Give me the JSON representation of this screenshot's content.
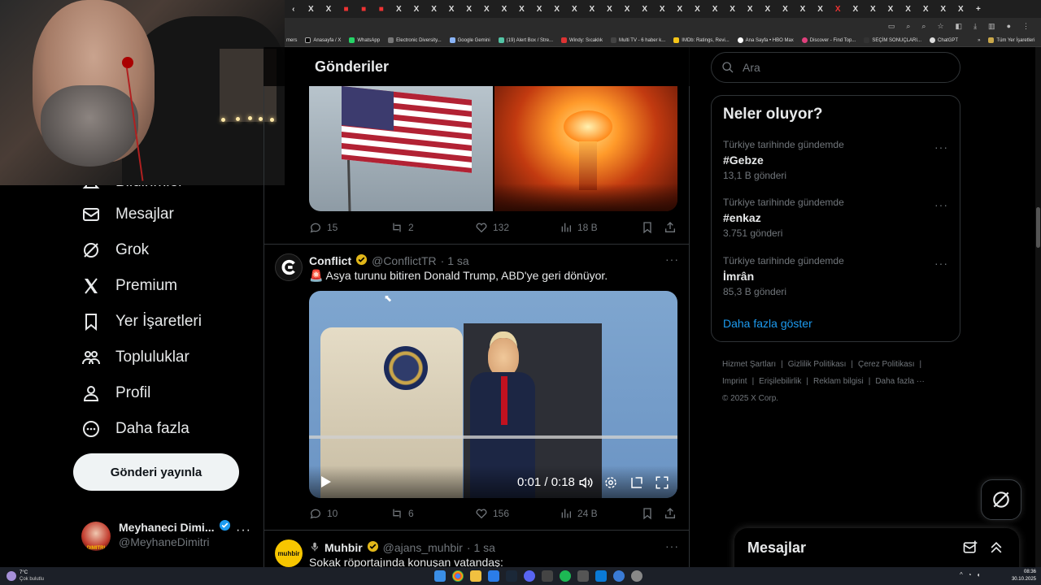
{
  "browser": {
    "bookmarks": [
      "mers",
      "Anasayfa / X",
      "WhatsApp",
      "Electronic Diversity...",
      "Google Gemini",
      "(19) Alert Box / Stre...",
      "Windy: Sıcaklık",
      "Multi TV - 6 haber k...",
      "IMDb: Ratings, Revi...",
      "Ana Sayfa • HBO Max",
      "Discover - Find Top...",
      "SEÇİM SONUÇLARI...",
      "ChatGPT",
      "Tüm Yer İşaretleri"
    ]
  },
  "left_nav": {
    "partial_item": "Bildirimler",
    "items": [
      {
        "label": "Mesajlar",
        "icon": "mail-icon"
      },
      {
        "label": "Grok",
        "icon": "grok-icon"
      },
      {
        "label": "Premium",
        "icon": "x-logo-icon"
      },
      {
        "label": "Yer İşaretleri",
        "icon": "bookmark-icon"
      },
      {
        "label": "Topluluklar",
        "icon": "communities-icon"
      },
      {
        "label": "Profil",
        "icon": "profile-icon"
      },
      {
        "label": "Daha fazla",
        "icon": "more-circle-icon"
      }
    ],
    "post_button": "Gönderi yayınla",
    "profile": {
      "name": "Meyhaneci Dimi...",
      "handle": "@MeyhaneDimitri",
      "avatar_text": "DIMITRI"
    }
  },
  "feed": {
    "header": "Gönderiler",
    "post1": {
      "replies": "15",
      "reposts": "2",
      "likes": "132",
      "views": "18 B"
    },
    "post2": {
      "name": "Conflict",
      "handle": "@ConflictTR",
      "time": "· 1 sa",
      "text": "🚨 Asya turunu bitiren Donald Trump, ABD'ye geri dönüyor.",
      "video_time": "0:01 / 0:18",
      "replies": "10",
      "reposts": "6",
      "likes": "156",
      "views": "24 B"
    },
    "post3": {
      "name": "Muhbir",
      "handle": "@ajans_muhbir",
      "time": "· 1 sa",
      "text": "Sokak röportajında konuşan vatandaş:",
      "avatar_text": "muhbir"
    }
  },
  "right": {
    "search_placeholder": "Ara",
    "trends_title": "Neler oluyor?",
    "trends": [
      {
        "context": "Türkiye tarihinde gündemde",
        "name": "#Gebze",
        "count": "13,1 B gönderi"
      },
      {
        "context": "Türkiye tarihinde gündemde",
        "name": "#enkaz",
        "count": "3.751 gönderi"
      },
      {
        "context": "Türkiye tarihinde gündemde",
        "name": "İmrân",
        "count": "85,3 B gönderi"
      }
    ],
    "show_more": "Daha fazla göster",
    "footer": {
      "row1": [
        "Hizmet Şartları",
        "Gizlilik Politikası",
        "Çerez Politikası"
      ],
      "row2": [
        "Imprint",
        "Erişilebilirlik",
        "Reklam bilgisi",
        "Daha fazla ···"
      ],
      "copyright": "© 2025 X Corp."
    },
    "messages_drawer": "Mesajlar"
  },
  "taskbar": {
    "weather_temp": "7°C",
    "weather_text": "Çok bulutlu",
    "time": "08:36",
    "date": "30.10.2025"
  },
  "colors": {
    "accent": "#1d9bf0",
    "verified_gold": "#e2b719",
    "bg": "#000000",
    "border": "#2f3336",
    "muted": "#71767b"
  }
}
